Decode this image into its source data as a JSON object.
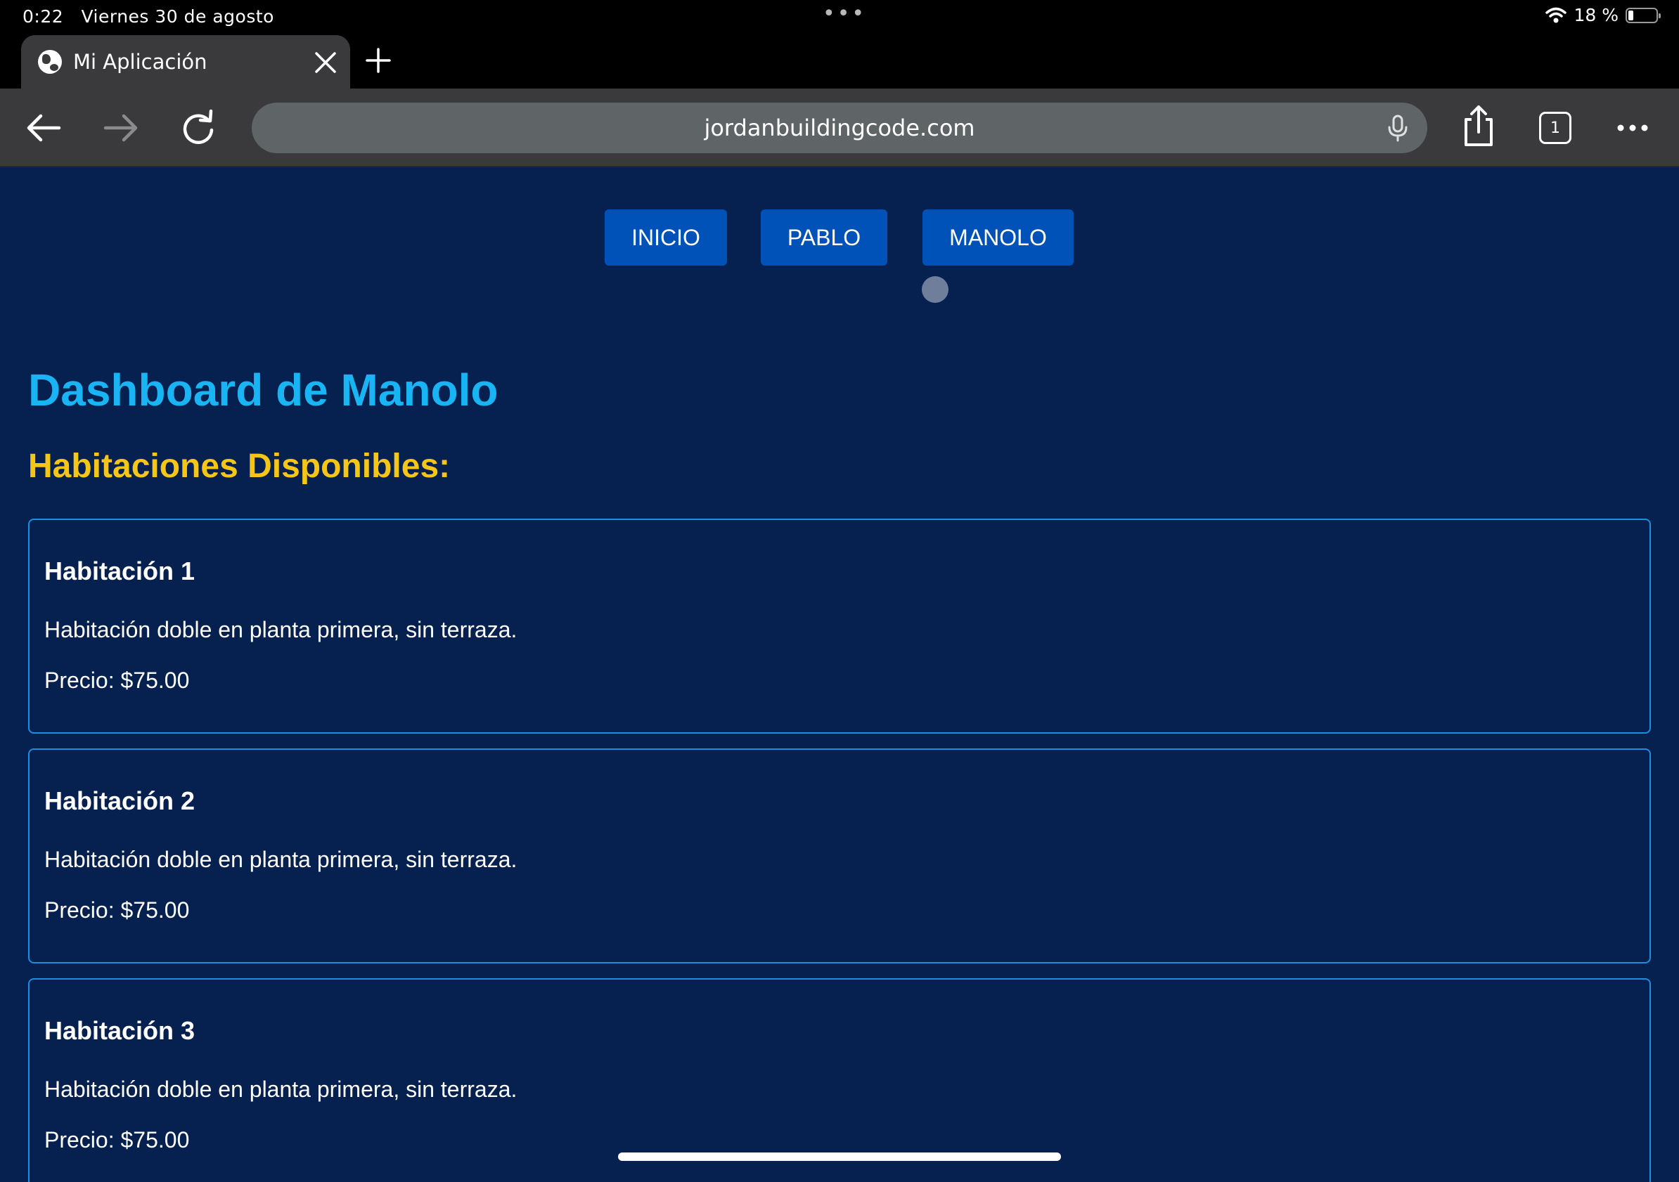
{
  "status_bar": {
    "time": "0:22",
    "date": "Viernes 30 de agosto",
    "dots": "•••",
    "battery": "18 %",
    "battery_level": 0.18
  },
  "browser": {
    "tab_title": "Mi Aplicación",
    "url": "jordanbuildingcode.com",
    "tab_count": "1"
  },
  "nav": {
    "items": [
      {
        "label": "INICIO"
      },
      {
        "label": "PABLO"
      },
      {
        "label": "MANOLO"
      }
    ]
  },
  "main": {
    "title": "Dashboard de Manolo",
    "subtitle": "Habitaciones Disponibles:"
  },
  "rooms": [
    {
      "name": "Habitación 1",
      "description": "Habitación doble en planta primera, sin terraza.",
      "price": "Precio: $75.00"
    },
    {
      "name": "Habitación 2",
      "description": "Habitación doble en planta primera, sin terraza.",
      "price": "Precio: $75.00"
    },
    {
      "name": "Habitación 3",
      "description": "Habitación doble en planta primera, sin terraza.",
      "price": "Precio: $75.00"
    }
  ],
  "colors": {
    "page_background": "#06204f",
    "button": "#0052b8",
    "title": "#18b4f3",
    "subtitle": "#f5c518",
    "card_border": "#1b8ee0"
  },
  "icons": [
    "wifi-icon",
    "battery-icon",
    "globe-icon",
    "close-icon",
    "plus-icon",
    "back-arrow-icon",
    "forward-arrow-icon",
    "reload-icon",
    "microphone-icon",
    "share-icon",
    "more-icon"
  ]
}
